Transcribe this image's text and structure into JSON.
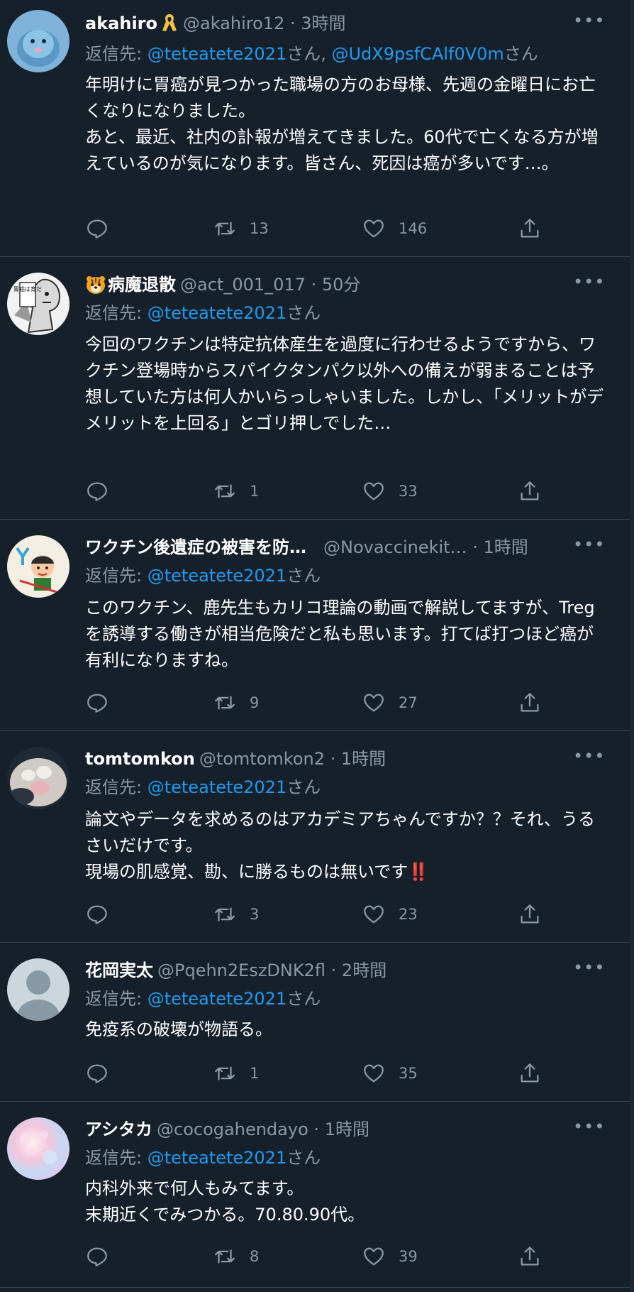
{
  "reply_prefix": "返信先: ",
  "reply_suffix": "さん",
  "reply_joiner": ", ",
  "tweets": [
    {
      "name": "akahiro",
      "handle": "@akahiro12",
      "sep": "·",
      "time": "3時間",
      "reply_to": [
        "@teteatete2021",
        "@UdX9psfCAlf0V0m"
      ],
      "text": "年明けに胃癌が見つかった職場の方のお母様、先週の金曜日にお亡くなりになりました。\nあと、最近、社内の訃報が増えてきました。60代で亡くなる方が増えているのが気になります。皆さん、死因は癌が多いです…。",
      "retweets": "13",
      "likes": "146",
      "badge": "ribbon-icon"
    },
    {
      "name": "病魔退散",
      "handle": "@act_001_017",
      "sep": "·",
      "time": "50分",
      "reply_to": [
        "@teteatete2021"
      ],
      "text": "今回のワクチンは特定抗体産生を過度に行わせるようですから、ワクチン登場時からスパイクタンパク以外への備えが弱まることは予想していた方は何人かいらっしゃいました。しかし、「メリットがデメリットを上回る」とゴリ押しでした…",
      "retweets": "1",
      "likes": "33",
      "badge": "tiger-emoji-icon"
    },
    {
      "name": "ワクチン後遺症の被害を防…",
      "handle": "@Novaccinekit…",
      "sep": "·",
      "time": "1時間",
      "reply_to": [
        "@teteatete2021"
      ],
      "text": "このワクチン、鹿先生もカリコ理論の動画で解説してますが、Tregを誘導する働きが相当危険だと私も思います。打てば打つほど癌が有利になりますね。",
      "retweets": "9",
      "likes": "27"
    },
    {
      "name": "tomtomkon",
      "handle": "@tomtomkon2",
      "sep": "·",
      "time": "1時間",
      "reply_to": [
        "@teteatete2021"
      ],
      "text": "論文やデータを求めるのはアカデミアちゃんですか？？それ、うるさいだけです。\n現場の肌感覚、勘、に勝るものは無いです",
      "text_emoji": "‼️",
      "retweets": "3",
      "likes": "23"
    },
    {
      "name": "花岡実太",
      "handle": "@Pqehn2EszDNK2fl",
      "sep": "·",
      "time": "2時間",
      "reply_to": [
        "@teteatete2021"
      ],
      "text": "免疫系の破壊が物語る。",
      "retweets": "1",
      "likes": "35"
    },
    {
      "name": "アシタカ",
      "handle": "@cocogahendayo",
      "sep": "·",
      "time": "1時間",
      "reply_to": [
        "@teteatete2021"
      ],
      "text": "内科外来で何人もみてます。\n末期近くでみつかる。70.80.90代。",
      "retweets": "8",
      "likes": "39"
    }
  ],
  "avatar_text": {
    "t1": "胃癌は育だ"
  },
  "colors": {
    "background": "#15202b",
    "divider": "#38444d",
    "secondary_text": "#8b98a5",
    "link": "#1d9bf0"
  }
}
